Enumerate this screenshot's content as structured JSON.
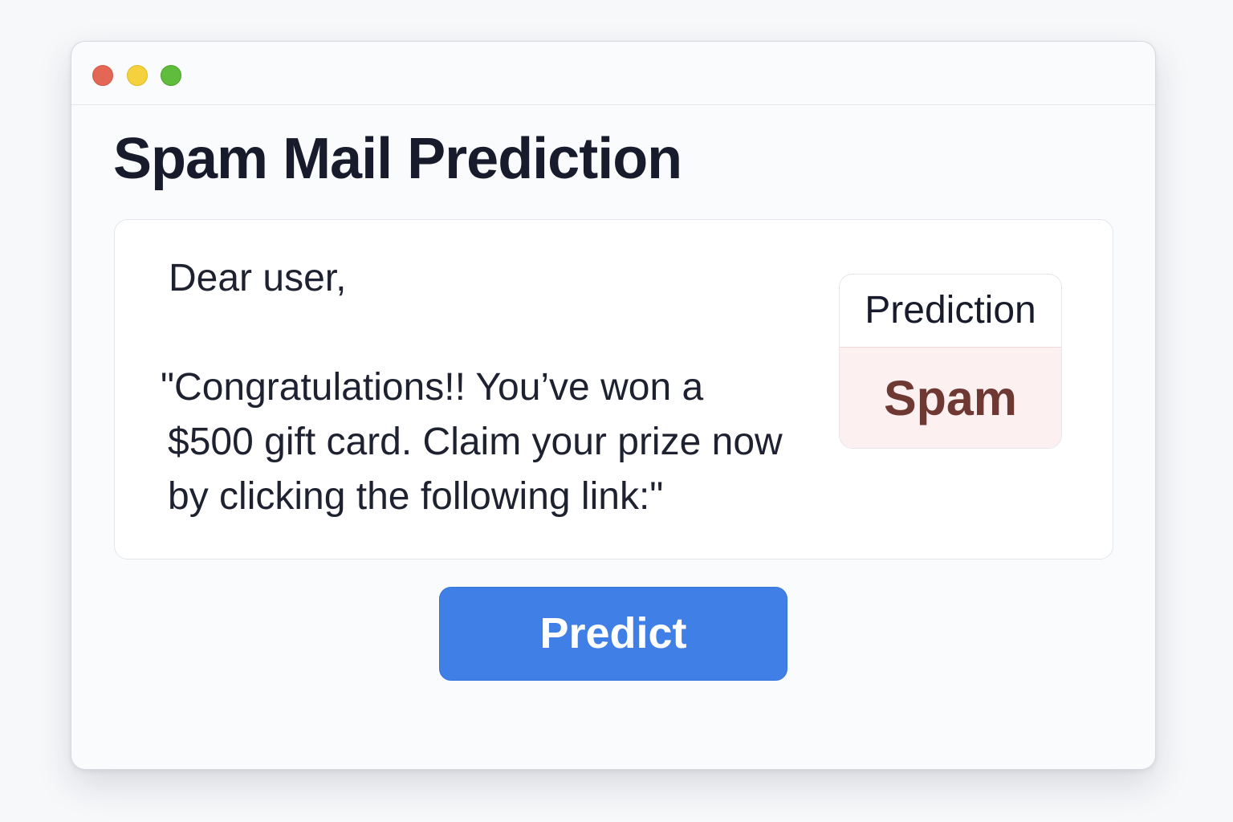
{
  "colors": {
    "page_background": "#f7f8fa",
    "window_background": "#fafbfd",
    "title_text": "#171b2b",
    "button_background": "#3f7fe6",
    "button_text": "#ffffff",
    "prediction_background": "#fdf0f1",
    "prediction_text": "#6e3932",
    "traffic_red": "#e46756",
    "traffic_yellow": "#f5d13d",
    "traffic_green": "#5fbc3d"
  },
  "window": {
    "controls": [
      {
        "name": "close-window-control-icon",
        "color": "#e46756"
      },
      {
        "name": "minimize-window-control-icon",
        "color": "#f5d13d"
      },
      {
        "name": "zoom-window-control-icon",
        "color": "#5fbc3d"
      }
    ]
  },
  "main": {
    "title": "Spam Mail Prediction",
    "email": {
      "greeting": "Dear user,",
      "message_lines": [
        "\"Congratulations!! You’ve won a",
        "$500 gift card. Claim your prize now",
        "by clicking the following link:\""
      ]
    },
    "prediction": {
      "label": "Prediction",
      "result": "Spam"
    },
    "actions": {
      "predict_label": "Predict"
    }
  }
}
